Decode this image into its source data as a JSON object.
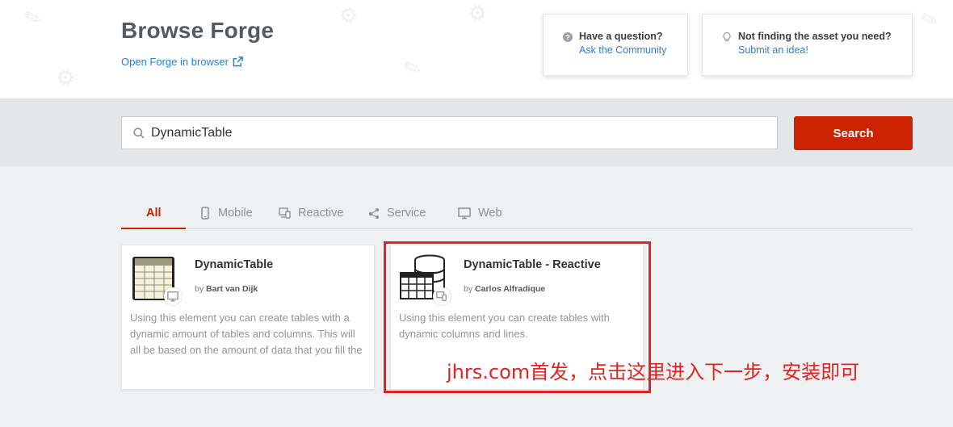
{
  "header": {
    "title": "Browse Forge",
    "open_link": "Open Forge in browser",
    "help_question": "Have a question?",
    "help_answer": "Ask the Community",
    "idea_question": "Not finding the asset you need?",
    "idea_answer": "Submit an idea!"
  },
  "search": {
    "value": "DynamicTable",
    "button_label": "Search"
  },
  "tabs": [
    {
      "label": "All",
      "icon": "all",
      "active": true
    },
    {
      "label": "Mobile",
      "icon": "mobile-icon"
    },
    {
      "label": "Reactive",
      "icon": "reactive-icon"
    },
    {
      "label": "Service",
      "icon": "service-icon"
    },
    {
      "label": "Web",
      "icon": "web-icon"
    }
  ],
  "results": [
    {
      "name": "DynamicTable",
      "by_prefix": "by",
      "author": "Bart van Dijk",
      "description": "Using this element you can create tables with a dynamic amount of tables and columns. This will all be based on the amount of data that you fill the",
      "badge_icon": "web-monitor-icon"
    },
    {
      "name": "DynamicTable - Reactive",
      "by_prefix": "by",
      "author": "Carlos Alfradique",
      "description": "Using this element you can create tables with dynamic columns and lines.",
      "badge_icon": "reactive-devices-icon"
    }
  ],
  "annotation": {
    "text": "jhrs.com首发，点击这里进入下一步，安装即可"
  },
  "colors": {
    "accent": "#cc2200",
    "link": "#2a7fd0",
    "annotation": "#e32222"
  }
}
